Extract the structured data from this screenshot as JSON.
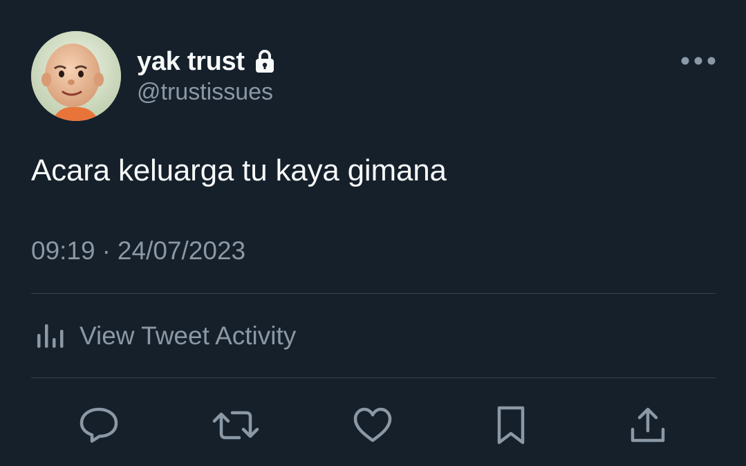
{
  "author": {
    "display_name": "yak trust",
    "handle": "@trustissues",
    "protected_icon": "lock-icon",
    "avatar_icon": "avatar"
  },
  "tweet": {
    "text": "Acara keluarga tu kaya gimana",
    "time": "09:19",
    "separator": "·",
    "date": "24/07/2023"
  },
  "activity": {
    "label": "View Tweet Activity",
    "icon": "analytics-bar-chart-icon"
  },
  "actions": [
    {
      "name": "reply",
      "icon": "reply-speech-bubble-icon"
    },
    {
      "name": "retweet",
      "icon": "retweet-arrows-icon"
    },
    {
      "name": "like",
      "icon": "heart-icon"
    },
    {
      "name": "bookmark",
      "icon": "bookmark-icon"
    },
    {
      "name": "share",
      "icon": "share-upload-icon"
    }
  ],
  "more_icon": "more-dots-icon",
  "colors": {
    "background": "#15202b",
    "primary_text": "#f7f9f9",
    "secondary_text": "#8b98a5",
    "divider": "#38444d"
  }
}
